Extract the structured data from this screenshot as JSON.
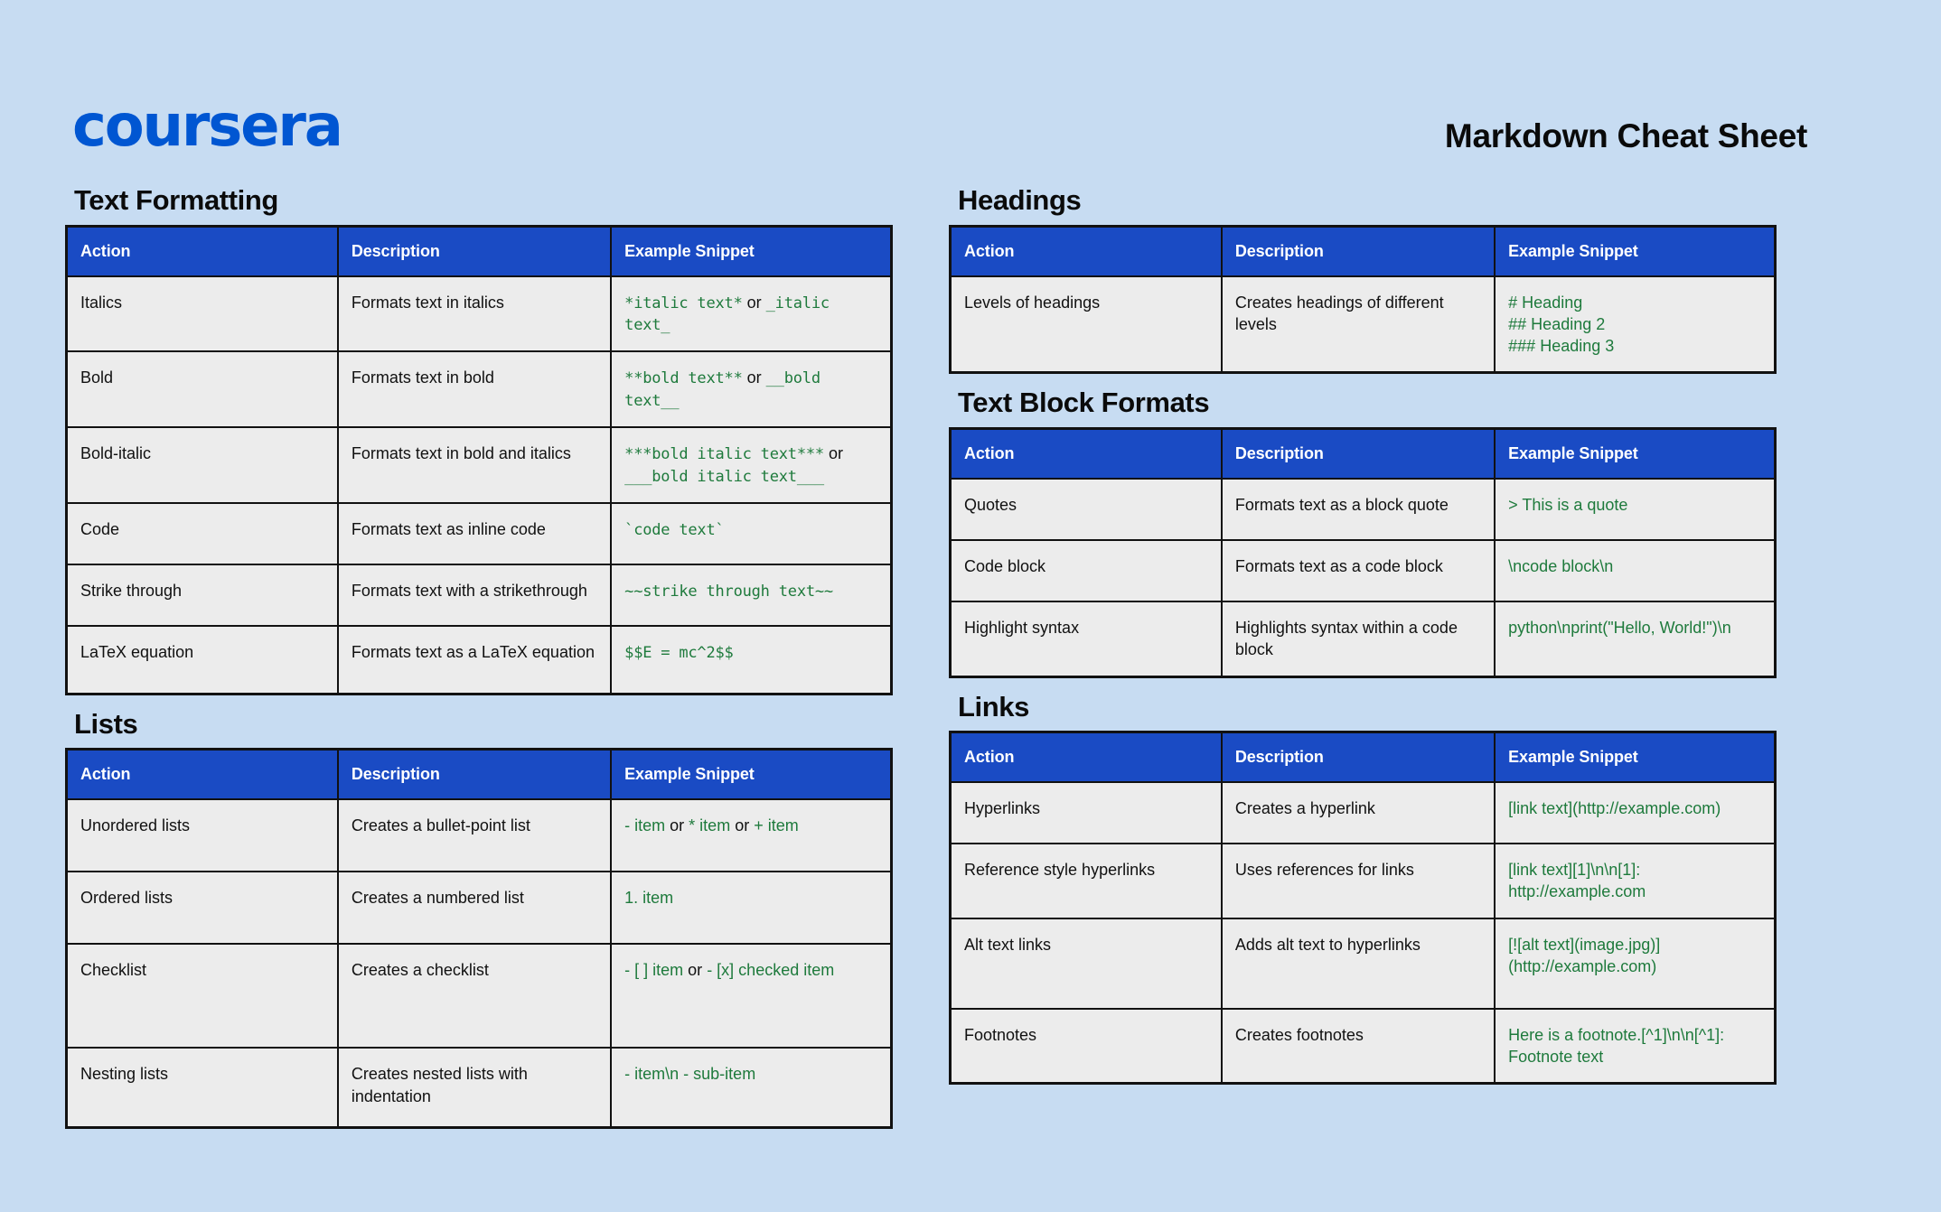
{
  "header": {
    "brand": "coursera",
    "title": "Markdown Cheat Sheet"
  },
  "colors": {
    "page_background": "#c7dcf2",
    "brand_blue": "#0056d2",
    "table_header_blue": "#1a4bc4",
    "cell_background": "#ececec",
    "code_green": "#1e7a3c",
    "border_black": "#111111"
  },
  "columns": {
    "header_labels": [
      "Action",
      "Description",
      "Example Snippet"
    ]
  },
  "sections": [
    {
      "id": "text-formatting",
      "title": "Text Formatting",
      "columns": [
        "Action",
        "Description",
        "Example Snippet"
      ],
      "snippet_font": "mono",
      "rows": [
        {
          "action": "Italics",
          "description": "Formats text in italics",
          "snippet_parts": [
            {
              "t": "code",
              "v": "*italic text*"
            },
            {
              "t": "plain",
              "v": " or "
            },
            {
              "t": "code",
              "v": "_italic text_"
            }
          ],
          "snippet_text": "*italic text* or _italic text_"
        },
        {
          "action": "Bold",
          "description": "Formats text in bold",
          "snippet_parts": [
            {
              "t": "code",
              "v": "**bold text**"
            },
            {
              "t": "plain",
              "v": " or "
            },
            {
              "t": "code",
              "v": "__bold text__"
            }
          ],
          "snippet_text": "**bold text** or __bold text__"
        },
        {
          "action": "Bold-italic",
          "description": "Formats text in bold and italics",
          "snippet_parts": [
            {
              "t": "code",
              "v": "***bold italic text***"
            },
            {
              "t": "plain",
              "v": " or "
            },
            {
              "t": "code",
              "v": "___bold italic text___"
            }
          ],
          "snippet_text": "***bold italic text*** or ___bold italic text___"
        },
        {
          "action": "Code",
          "description": "Formats text as inline code",
          "snippet_parts": [
            {
              "t": "code",
              "v": "`code text`"
            }
          ],
          "snippet_text": "`code text`"
        },
        {
          "action": "Strike through",
          "description": "Formats text with a strikethrough",
          "snippet_parts": [
            {
              "t": "code",
              "v": "~~strike through text~~"
            }
          ],
          "snippet_text": "~~strike through text~~"
        },
        {
          "action": "LaTeX equation",
          "description": "Formats text as a LaTeX equation",
          "snippet_parts": [
            {
              "t": "code",
              "v": "$$E = mc^2$$"
            }
          ],
          "snippet_text": "$$E = mc^2$$"
        }
      ]
    },
    {
      "id": "lists",
      "title": "Lists",
      "columns": [
        "Action",
        "Description",
        "Example Snippet"
      ],
      "snippet_font": "sans",
      "rows": [
        {
          "action": "Unordered lists",
          "description": "Creates a bullet-point list",
          "snippet_parts": [
            {
              "t": "code",
              "v": "- item"
            },
            {
              "t": "plain",
              "v": " or "
            },
            {
              "t": "code",
              "v": "* item"
            },
            {
              "t": "plain",
              "v": " or "
            },
            {
              "t": "code",
              "v": "+ item"
            }
          ],
          "snippet_text": "- item or * item or + item"
        },
        {
          "action": "Ordered lists",
          "description": "Creates a numbered list",
          "snippet_parts": [
            {
              "t": "code",
              "v": "1. item"
            }
          ],
          "snippet_text": "1. item"
        },
        {
          "action": "Checklist",
          "description": "Creates a checklist",
          "snippet_parts": [
            {
              "t": "code",
              "v": "- [ ] item"
            },
            {
              "t": "plain",
              "v": " or "
            },
            {
              "t": "code",
              "v": "- [x] checked item"
            }
          ],
          "snippet_text": "- [ ] item or - [x] checked item"
        },
        {
          "action": "Nesting lists",
          "description": "Creates nested lists with indentation",
          "snippet_parts": [
            {
              "t": "code",
              "v": "- item\\n  - sub-item"
            }
          ],
          "snippet_text": "- item\\n  - sub-item"
        }
      ]
    }
  ],
  "sections_right": [
    {
      "id": "headings",
      "title": "Headings",
      "columns": [
        "Action",
        "Description",
        "Example Snippet"
      ],
      "snippet_font": "sans",
      "rows": [
        {
          "action": "Levels of headings",
          "description": "Creates headings of different levels",
          "snippet_lines": [
            "# Heading",
            "## Heading 2",
            "### Heading 3"
          ],
          "snippet_text": "# Heading ## Heading 2 ### Heading 3"
        }
      ]
    },
    {
      "id": "text-block-formats",
      "title": "Text Block Formats",
      "columns": [
        "Action",
        "Description",
        "Example Snippet"
      ],
      "snippet_font": "sans",
      "rows": [
        {
          "action": "Quotes",
          "description": "Formats text as a block quote",
          "snippet_lines": [
            "> This is a quote"
          ],
          "snippet_text": "> This is a quote"
        },
        {
          "action": "Code block",
          "description": "Formats text as a code block",
          "snippet_lines": [
            "\\ncode block\\n"
          ],
          "snippet_text": "\\ncode block\\n"
        },
        {
          "action": "Highlight syntax",
          "description": "Highlights syntax within a code block",
          "snippet_lines": [
            "python\\nprint(\"Hello, World!\")\\n"
          ],
          "snippet_text": "python\\nprint(\"Hello, World!\")\\n"
        }
      ]
    },
    {
      "id": "links",
      "title": "Links",
      "columns": [
        "Action",
        "Description",
        "Example Snippet"
      ],
      "snippet_font": "sans",
      "rows": [
        {
          "action": "Hyperlinks",
          "description": "Creates a hyperlink",
          "snippet_lines": [
            "[link text](http://example.com)"
          ],
          "snippet_text": "[link text](http://example.com)"
        },
        {
          "action": "Reference style hyperlinks",
          "description": "Uses references for links",
          "snippet_lines": [
            "[link text][1]\\n\\n[1]: http://example.com"
          ],
          "snippet_text": "[link text][1]\\n\\n[1]: http://example.com"
        },
        {
          "action": "Alt text links",
          "description": "Adds alt text to hyperlinks",
          "snippet_lines": [
            "[![alt text](image.jpg)](http://example.com)"
          ],
          "snippet_text": "[![alt text](image.jpg)](http://example.com)"
        },
        {
          "action": "Footnotes",
          "description": "Creates footnotes",
          "snippet_lines": [
            "Here is a footnote.[^1]\\n\\n[^1]: Footnote text"
          ],
          "snippet_text": "Here is a footnote.[^1]\\n\\n[^1]: Footnote text"
        }
      ]
    }
  ]
}
